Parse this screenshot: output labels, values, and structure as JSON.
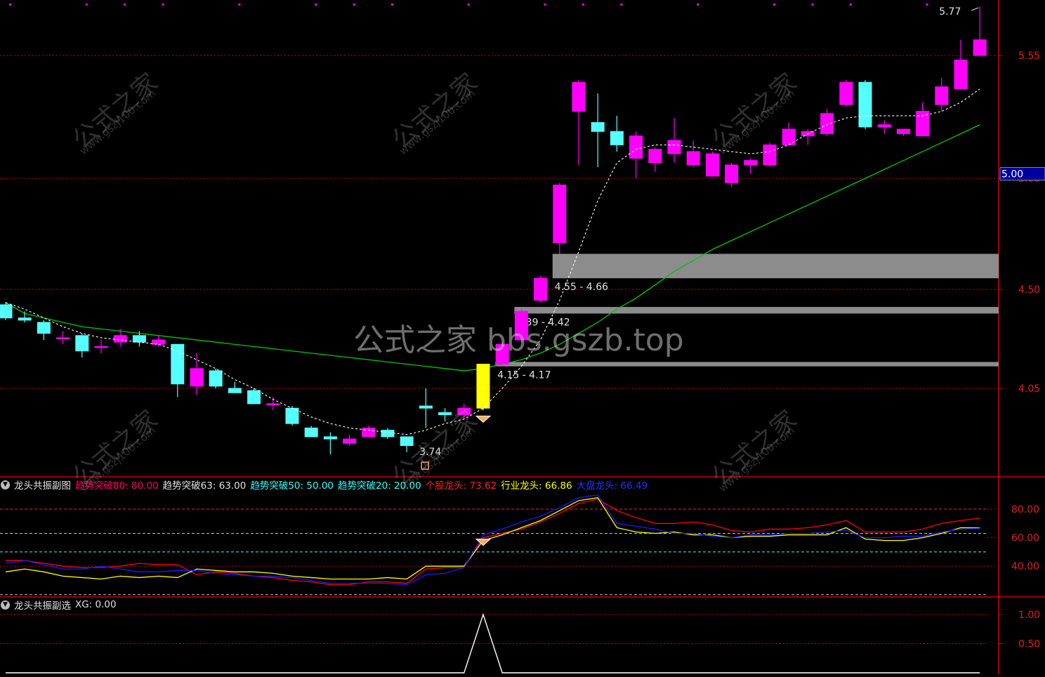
{
  "colors": {
    "background": "#000000",
    "up": "#ff00ff",
    "down": "#54ffff",
    "ma_dashed": "#ffffff",
    "ma_long": "#00c800",
    "zone": "#8c8c8c",
    "axis": "#cc0000",
    "grid": "#c00000",
    "signal": "#ffff00",
    "line_individual": "#ff0000",
    "line_industry": "#ffff00",
    "line_market": "#1a1aff"
  },
  "watermark": {
    "main": "公式之家 bbs.gszb.top",
    "tile_text": "公式之家",
    "tile_url": "www.gszj100.com"
  },
  "main_panel": {
    "y_ticks": [
      "5.55",
      "5.00",
      "4.50",
      "4.05"
    ],
    "current_price_label": "5.00",
    "high_label": "5.77",
    "low_label": "3.74",
    "zones": [
      {
        "label": "4.55 - 4.66",
        "low": 4.55,
        "high": 4.66
      },
      {
        "label": "4.39 - 4.42",
        "low": 4.39,
        "high": 4.42
      },
      {
        "label": "4.15 - 4.17",
        "low": 4.15,
        "high": 4.17
      }
    ]
  },
  "sub1": {
    "title": "龙头共振副图",
    "items": [
      {
        "text": "趋势突破80: 80.00",
        "color": "#ff0066"
      },
      {
        "text": "趋势突破63: 63.00",
        "color": "#e0e0e0"
      },
      {
        "text": "趋势突破50: 50.00",
        "color": "#33ffff"
      },
      {
        "text": "趋势突破20: 20.00",
        "color": "#33ffff"
      },
      {
        "text": "个股龙头: 73.62",
        "color": "#ff2020"
      },
      {
        "text": "行业龙头: 66.86",
        "color": "#ffff00"
      },
      {
        "text": "大盘龙头: 66.49",
        "color": "#2233ff"
      }
    ],
    "y_ticks": [
      "80.00",
      "60.00",
      "40.00"
    ]
  },
  "sub2": {
    "title": "龙头共振副选",
    "items": [
      {
        "text": "XG: 0.00",
        "color": "#e0e0e0"
      }
    ],
    "y_ticks": [
      "1.00",
      "0.50"
    ]
  },
  "chart_data": {
    "type": "candlestick",
    "panels": [
      {
        "name": "main",
        "candles": [
          {
            "o": 4.43,
            "c": 4.37,
            "h": 4.44,
            "l": 4.36
          },
          {
            "o": 4.37,
            "c": 4.36,
            "h": 4.4,
            "l": 4.35
          },
          {
            "o": 4.35,
            "c": 4.3,
            "h": 4.36,
            "l": 4.27
          },
          {
            "o": 4.28,
            "c": 4.28,
            "h": 4.31,
            "l": 4.25
          },
          {
            "o": 4.29,
            "c": 4.22,
            "h": 4.3,
            "l": 4.19
          },
          {
            "o": 4.24,
            "c": 4.24,
            "h": 4.27,
            "l": 4.21
          },
          {
            "o": 4.26,
            "c": 4.29,
            "h": 4.32,
            "l": 4.24
          },
          {
            "o": 4.29,
            "c": 4.26,
            "h": 4.31,
            "l": 4.24
          },
          {
            "o": 4.25,
            "c": 4.27,
            "h": 4.29,
            "l": 4.24
          },
          {
            "o": 4.25,
            "c": 4.07,
            "h": 4.25,
            "l": 4.01
          },
          {
            "o": 4.06,
            "c": 4.14,
            "h": 4.21,
            "l": 4.02
          },
          {
            "o": 4.13,
            "c": 4.06,
            "h": 4.14,
            "l": 4.05
          },
          {
            "o": 4.05,
            "c": 4.03,
            "h": 4.08,
            "l": 4.03
          },
          {
            "o": 4.04,
            "c": 3.98,
            "h": 4.05,
            "l": 3.98
          },
          {
            "o": 3.98,
            "c": 3.98,
            "h": 4.01,
            "l": 3.95
          },
          {
            "o": 3.96,
            "c": 3.89,
            "h": 3.97,
            "l": 3.88
          },
          {
            "o": 3.87,
            "c": 3.83,
            "h": 3.88,
            "l": 3.83
          },
          {
            "o": 3.83,
            "c": 3.82,
            "h": 3.85,
            "l": 3.75
          },
          {
            "o": 3.8,
            "c": 3.82,
            "h": 3.84,
            "l": 3.79
          },
          {
            "o": 3.83,
            "c": 3.87,
            "h": 3.88,
            "l": 3.83
          },
          {
            "o": 3.86,
            "c": 3.83,
            "h": 3.87,
            "l": 3.82
          },
          {
            "o": 3.83,
            "c": 3.79,
            "h": 3.83,
            "l": 3.76
          },
          {
            "o": 3.97,
            "c": 3.96,
            "h": 4.05,
            "l": 3.87
          },
          {
            "o": 3.94,
            "c": 3.93,
            "h": 3.96,
            "l": 3.9
          },
          {
            "o": 3.93,
            "c": 3.96,
            "h": 3.98,
            "l": 3.91
          },
          {
            "o": 3.96,
            "c": 4.16,
            "h": 4.16,
            "l": 3.95
          },
          {
            "o": 4.16,
            "c": 4.25,
            "h": 4.26,
            "l": 4.15
          },
          {
            "o": 4.27,
            "c": 4.4,
            "h": 4.41,
            "l": 4.26
          },
          {
            "o": 4.45,
            "c": 4.55,
            "h": 4.56,
            "l": 4.44
          },
          {
            "o": 4.71,
            "c": 4.97,
            "h": 4.98,
            "l": 4.66
          },
          {
            "o": 5.3,
            "c": 5.43,
            "h": 5.44,
            "l": 5.06
          },
          {
            "o": 5.25,
            "c": 5.21,
            "h": 5.38,
            "l": 5.05
          },
          {
            "o": 5.21,
            "c": 5.15,
            "h": 5.28,
            "l": 5.12
          },
          {
            "o": 5.09,
            "c": 5.19,
            "h": 5.21,
            "l": 5.0
          },
          {
            "o": 5.07,
            "c": 5.13,
            "h": 5.14,
            "l": 5.03
          },
          {
            "o": 5.11,
            "c": 5.17,
            "h": 5.27,
            "l": 5.07
          },
          {
            "o": 5.06,
            "c": 5.12,
            "h": 5.17,
            "l": 5.05
          },
          {
            "o": 5.01,
            "c": 5.11,
            "h": 5.12,
            "l": 5.01
          },
          {
            "o": 4.98,
            "c": 5.06,
            "h": 5.07,
            "l": 4.96
          },
          {
            "o": 5.06,
            "c": 5.08,
            "h": 5.09,
            "l": 5.02
          },
          {
            "o": 5.06,
            "c": 5.15,
            "h": 5.16,
            "l": 5.05
          },
          {
            "o": 5.15,
            "c": 5.22,
            "h": 5.25,
            "l": 5.15
          },
          {
            "o": 5.19,
            "c": 5.21,
            "h": 5.22,
            "l": 5.15
          },
          {
            "o": 5.2,
            "c": 5.29,
            "h": 5.31,
            "l": 5.19
          },
          {
            "o": 5.33,
            "c": 5.43,
            "h": 5.44,
            "l": 5.32
          },
          {
            "o": 5.43,
            "c": 5.23,
            "h": 5.44,
            "l": 5.22
          },
          {
            "o": 5.23,
            "c": 5.24,
            "h": 5.26,
            "l": 5.2
          },
          {
            "o": 5.2,
            "c": 5.22,
            "h": 5.22,
            "l": 5.19
          },
          {
            "o": 5.19,
            "c": 5.3,
            "h": 5.34,
            "l": 5.19
          },
          {
            "o": 5.33,
            "c": 5.41,
            "h": 5.45,
            "l": 5.3
          },
          {
            "o": 5.4,
            "c": 5.53,
            "h": 5.62,
            "l": 5.4
          },
          {
            "o": 5.55,
            "c": 5.62,
            "h": 5.77,
            "l": 5.55
          }
        ],
        "ma_short": [
          4.44,
          4.41,
          4.37,
          4.33,
          4.3,
          4.28,
          4.27,
          4.26,
          4.25,
          4.22,
          4.18,
          4.14,
          4.09,
          4.05,
          4.0,
          3.96,
          3.92,
          3.89,
          3.87,
          3.86,
          3.85,
          3.84,
          3.86,
          3.89,
          3.91,
          3.96,
          4.05,
          4.15,
          4.27,
          4.45,
          4.67,
          4.9,
          5.07,
          5.13,
          5.15,
          5.15,
          5.14,
          5.13,
          5.12,
          5.11,
          5.12,
          5.15,
          5.2,
          5.24,
          5.27,
          5.28,
          5.28,
          5.28,
          5.28,
          5.3,
          5.34,
          5.4
        ],
        "ma_long": [
          4.44,
          4.39,
          4.37,
          4.35,
          4.33,
          4.32,
          4.31,
          4.3,
          4.29,
          4.28,
          4.27,
          4.26,
          4.25,
          4.24,
          4.23,
          4.22,
          4.21,
          4.2,
          4.19,
          4.18,
          4.17,
          4.16,
          4.15,
          4.14,
          4.13,
          4.14,
          4.16,
          4.18,
          4.21,
          4.25,
          4.3,
          4.35,
          4.41,
          4.46,
          4.52,
          4.58,
          4.63,
          4.68,
          4.72,
          4.76,
          4.8,
          4.84,
          4.88,
          4.92,
          4.96,
          5.0,
          5.04,
          5.08,
          5.12,
          5.16,
          5.2,
          5.24
        ]
      },
      {
        "name": "sub1",
        "series": [
          {
            "name": "个股龙头",
            "values": [
              44,
              44,
              42,
              40,
              39,
              39,
              40,
              42,
              41,
              41,
              34,
              36,
              35,
              33,
              32,
              30,
              29,
              27,
              27,
              29,
              29,
              28,
              38,
              39,
              39,
              60,
              63,
              66,
              71,
              77,
              84,
              87,
              79,
              74,
              70,
              70,
              71,
              69,
              65,
              64,
              66,
              66,
              67,
              69,
              72,
              64,
              64,
              64,
              66,
              70,
              72,
              73.62
            ]
          },
          {
            "name": "行业龙头",
            "values": [
              36,
              38,
              36,
              33,
              32,
              31,
              33,
              32,
              33,
              32,
              38,
              37,
              36,
              36,
              35,
              33,
              32,
              31,
              31,
              31,
              32,
              31,
              40,
              40,
              40,
              58,
              62,
              67,
              72,
              79,
              86,
              88,
              67,
              64,
              63,
              64,
              62,
              62,
              60,
              61,
              61,
              62,
              62,
              62,
              67,
              59,
              58,
              58,
              60,
              63,
              67,
              66.86
            ]
          },
          {
            "name": "大盘龙头",
            "values": [
              42,
              44,
              41,
              38,
              38,
              40,
              38,
              36,
              36,
              37,
              37,
              35,
              34,
              33,
              33,
              32,
              30,
              28,
              28,
              28,
              28,
              27,
              34,
              35,
              39,
              62,
              66,
              71,
              75,
              81,
              88,
              90,
              70,
              68,
              66,
              63,
              63,
              61,
              60,
              62,
              62,
              63,
              63,
              64,
              65,
              60,
              60,
              61,
              61,
              64,
              66,
              66.49
            ]
          }
        ],
        "ref_levels": [
          80,
          63,
          50,
          20
        ],
        "ylim": [
          20,
          100
        ]
      },
      {
        "name": "sub2",
        "series": [
          {
            "name": "XG",
            "values": [
              0,
              0,
              0,
              0,
              0,
              0,
              0,
              0,
              0,
              0,
              0,
              0,
              0,
              0,
              0,
              0,
              0,
              0,
              0,
              0,
              0,
              0,
              0,
              0,
              0,
              1,
              0,
              0,
              0,
              0,
              0,
              0,
              0,
              0,
              0,
              0,
              0,
              0,
              0,
              0,
              0,
              0,
              0,
              0,
              0,
              0,
              0,
              0,
              0,
              0,
              0,
              0
            ]
          }
        ],
        "ylim": [
          0,
          1.2
        ]
      }
    ],
    "signal_index": 25,
    "low_marker_index": 21
  }
}
